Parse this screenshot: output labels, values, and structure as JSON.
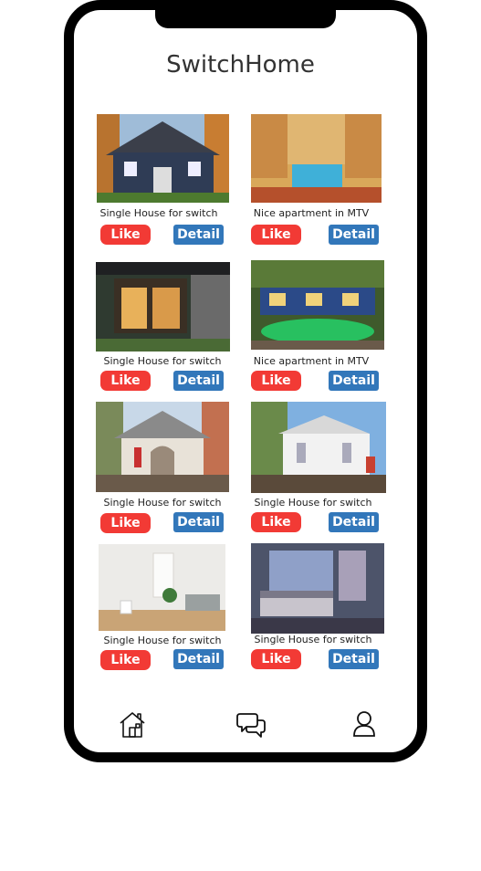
{
  "app": {
    "title": "SwitchHome"
  },
  "listings": [
    {
      "caption": "Single House for switch",
      "like": "Like",
      "detail": "Detail"
    },
    {
      "caption": "Nice apartment in MTV",
      "like": "Like",
      "detail": "Detail"
    },
    {
      "caption": "Single House for switch",
      "like": "Like",
      "detail": "Detail"
    },
    {
      "caption": "Nice apartment in MTV",
      "like": "Like",
      "detail": "Detail"
    },
    {
      "caption": "Single House for switch",
      "like": "Like",
      "detail": "Detail"
    },
    {
      "caption": "Single House for switch",
      "like": "Like",
      "detail": "Detail"
    },
    {
      "caption": "Single House for switch",
      "like": "Like",
      "detail": "Detail"
    },
    {
      "caption": "Single House for switch",
      "like": "Like",
      "detail": "Detail"
    }
  ],
  "nav": {
    "icons": [
      "home-icon",
      "chat-icon",
      "profile-icon"
    ]
  },
  "colors": {
    "like": "#f23a35",
    "detail": "#3277ba",
    "frame": "#000000"
  }
}
